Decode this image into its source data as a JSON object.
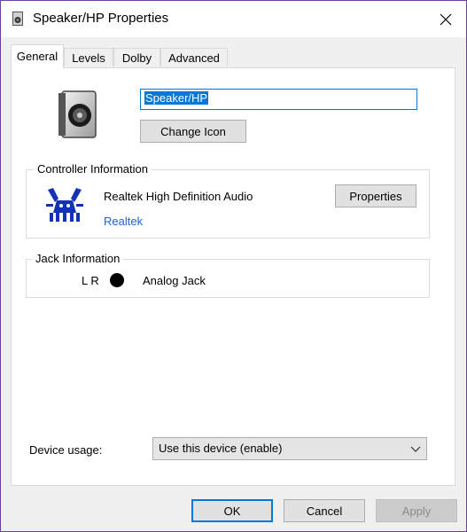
{
  "window": {
    "title": "Speaker/HP Properties",
    "title_icon": "speaker-icon",
    "close_icon": "close-icon"
  },
  "tabs": [
    {
      "label": "General",
      "active": true
    },
    {
      "label": "Levels",
      "active": false
    },
    {
      "label": "Dolby",
      "active": false
    },
    {
      "label": "Advanced",
      "active": false
    }
  ],
  "general": {
    "device_icon": "speaker-icon",
    "name_value": "Speaker/HP",
    "change_icon_label": "Change Icon",
    "controller": {
      "title": "Controller Information",
      "logo": "realtek-logo",
      "name": "Realtek High Definition Audio",
      "vendor": "Realtek",
      "properties_label": "Properties"
    },
    "jack": {
      "title": "Jack Information",
      "channels": "L R",
      "dot_color": "#000000",
      "type": "Analog Jack"
    },
    "usage": {
      "label": "Device usage:",
      "selected": "Use this device (enable)"
    }
  },
  "footer": {
    "ok_label": "OK",
    "cancel_label": "Cancel",
    "apply_label": "Apply"
  },
  "colors": {
    "accent": "#0078d7",
    "window_border": "#6b3fa0",
    "link": "#2563c7"
  }
}
